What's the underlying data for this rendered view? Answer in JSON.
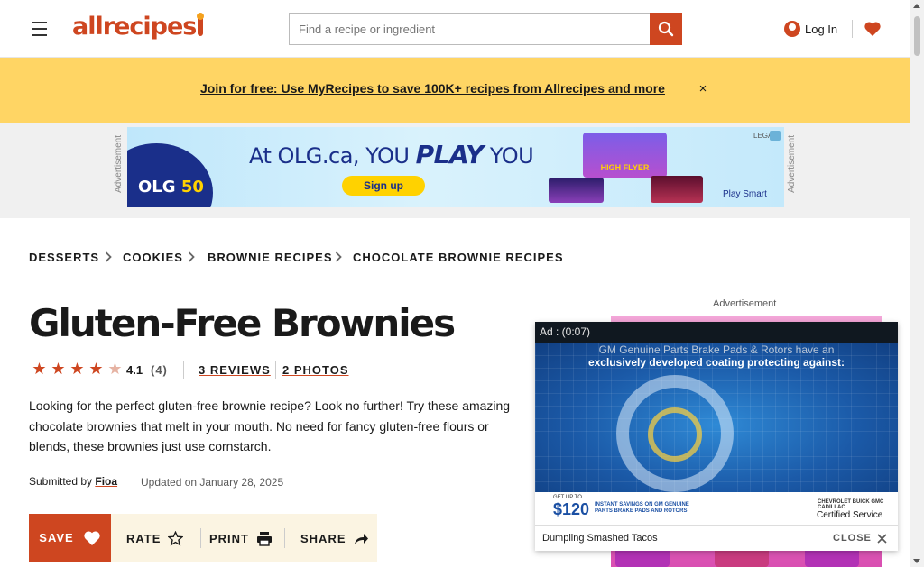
{
  "header": {
    "logo_text": "allrecipes",
    "search_placeholder": "Find a recipe or ingredient",
    "login_label": "Log In"
  },
  "promo": {
    "text": "Join for free: Use MyRecipes to save 100K+ recipes from Allrecipes and more",
    "close_glyph": "×"
  },
  "top_ad": {
    "side_label": "Advertisement",
    "brand": "OLG",
    "brand_number": "50",
    "headline_pre": "At OLG.ca, ",
    "headline_you": "YOU ",
    "headline_play": "PLAY",
    "headline_post": " YOU",
    "cta": "Sign up",
    "game_title": "HIGH FLYER",
    "footer": "Play Smart",
    "legal": "LEGAL"
  },
  "breadcrumb": [
    "DESSERTS",
    "COOKIES",
    "BROWNIE RECIPES",
    "CHOCOLATE BROWNIE RECIPES"
  ],
  "recipe": {
    "title": "Gluten-Free Brownies",
    "rating_value": "4.1",
    "rating_count": "(4)",
    "reviews_link": "3 REVIEWS",
    "photos_link": "2 PHOTOS",
    "description_lines": [
      "Looking for the perfect gluten-free brownie recipe? Look no further! Try these amazing",
      "chocolate brownies that melt in your mouth. No need for fancy gluten-free flours or",
      "blends, these brownies just use cornstarch."
    ],
    "submitted_prefix": "Submitted by ",
    "author": "Fioa",
    "updated": "Updated on January 28, 2025"
  },
  "actions": {
    "save": "SAVE",
    "rate": "RATE",
    "print": "PRINT",
    "share": "SHARE"
  },
  "right_ad": {
    "label": "Advertisement"
  },
  "video_ad": {
    "ad_time": "Ad : (0:07)",
    "caption_line1": "GM Genuine Parts Brake Pads & Rotors have an",
    "caption_line2": "exclusively developed coating protecting against:",
    "fine_print": "GET UP TO",
    "price": "$120",
    "offer_line1": "INSTANT SAVINGS ON GM GENUINE",
    "offer_line2": "PARTS BRAKE PADS AND ROTORS",
    "brands": "CHEVROLET BUICK GMC CADILLAC",
    "certified": "Certified Service",
    "video_title": "Dumpling Smashed Tacos",
    "close_label": "CLOSE"
  },
  "colors": {
    "brand": "#ce4620",
    "promo_bg": "#ffd564",
    "action_bg": "#fbf4e2"
  }
}
